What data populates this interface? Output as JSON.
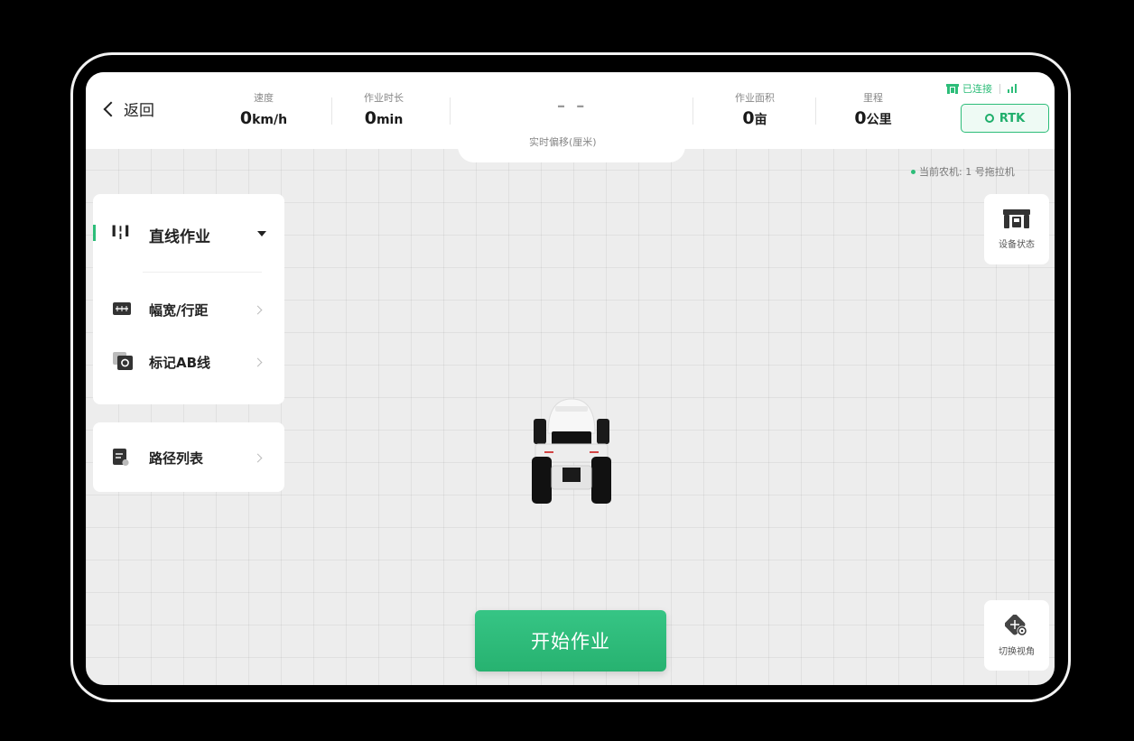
{
  "header": {
    "back_label": "返回",
    "speed": {
      "label": "速度",
      "value": "0",
      "unit": "km/h"
    },
    "duration": {
      "label": "作业时长",
      "value": "0",
      "unit": "min"
    },
    "offset": {
      "value": "– –",
      "label": "实时偏移(厘米)"
    },
    "area": {
      "label": "作业面积",
      "value": "0",
      "unit": "亩"
    },
    "distance": {
      "label": "里程",
      "value": "0",
      "unit": "公里"
    },
    "connection": {
      "status": "已连接"
    },
    "rtk_label": "RTK"
  },
  "current_machine": "当前农机: 1 号拖拉机",
  "left_panel": {
    "mode_label": "直线作业",
    "width_label": "幅宽/行距",
    "mark_ab_label": "标记AB线",
    "route_list_label": "路径列表"
  },
  "right_panel": {
    "device_status_label": "设备状态",
    "switch_view_label": "切换视角"
  },
  "start_button_label": "开始作业",
  "colors": {
    "accent": "#2dbd79",
    "button": "#2fbb7a"
  }
}
